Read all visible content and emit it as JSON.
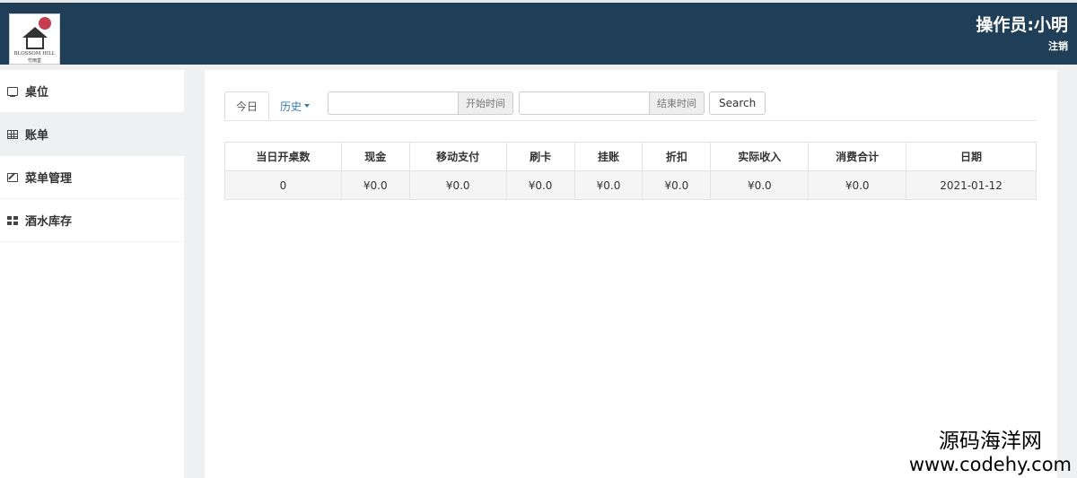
{
  "header": {
    "logo_brand": "BLOSSOM HILL",
    "logo_sub": "竹雨堂",
    "operator": "操作员:小明",
    "logout": "注销",
    "bg_color": "#1f3f58"
  },
  "sidebar": {
    "items": [
      {
        "label": "桌位",
        "icon": "monitor-icon"
      },
      {
        "label": "账单",
        "icon": "table-icon"
      },
      {
        "label": "菜单管理",
        "icon": "edit-icon"
      },
      {
        "label": "酒水库存",
        "icon": "grid-icon"
      }
    ]
  },
  "main": {
    "tabs": [
      {
        "label": "今日"
      },
      {
        "label": "历史"
      }
    ],
    "start_addon": "开始时间",
    "end_addon": "结束时间",
    "start_value": "",
    "end_value": "",
    "search_label": "Search"
  },
  "table": {
    "headers": [
      "当日开桌数",
      "现金",
      "移动支付",
      "刷卡",
      "挂账",
      "折扣",
      "实际收入",
      "消费合计",
      "日期"
    ],
    "rows": [
      [
        "0",
        "¥0.0",
        "¥0.0",
        "¥0.0",
        "¥0.0",
        "¥0.0",
        "¥0.0",
        "¥0.0",
        "2021-01-12"
      ]
    ]
  },
  "watermark": {
    "line1": "源码海洋网",
    "line2": "www.codehy.com"
  }
}
